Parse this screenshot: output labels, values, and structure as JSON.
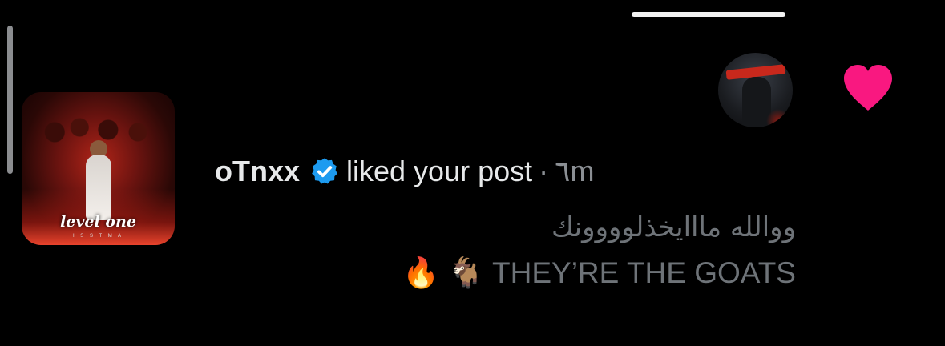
{
  "notification": {
    "username": "oTnxx",
    "action": "liked your post",
    "separator": "·",
    "time": "٦m",
    "comment": {
      "line1": "ووالله مااايخذلوووونك",
      "line2": "🔥 🐐 THEY’RE THE GOATS"
    },
    "post_thumbnail": {
      "brand": "level one",
      "brand_sub": "I S S T M A"
    },
    "icons": {
      "reaction": "heart-icon",
      "badge": "verified-badge-icon"
    },
    "colors": {
      "heart": "#f91880",
      "verified": "#1d9bf0",
      "background": "#000000",
      "secondary_text": "#6e7378"
    }
  }
}
